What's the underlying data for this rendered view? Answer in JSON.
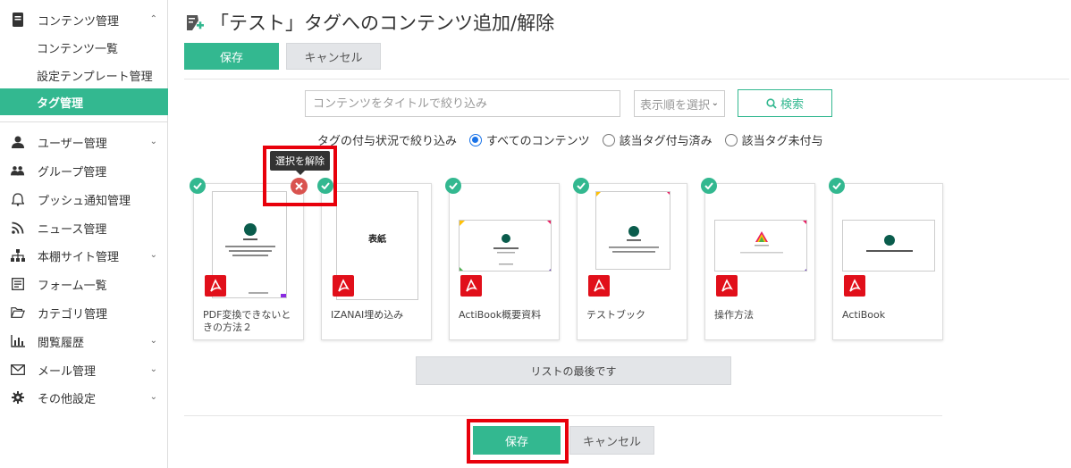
{
  "sidebar": {
    "content_mgmt": "コンテンツ管理",
    "content_list": "コンテンツ一覧",
    "template_mgmt": "設定テンプレート管理",
    "tag_mgmt": "タグ管理",
    "user_mgmt": "ユーザー管理",
    "group_mgmt": "グループ管理",
    "push_mgmt": "プッシュ通知管理",
    "news_mgmt": "ニュース管理",
    "shelf_mgmt": "本棚サイト管理",
    "form_list": "フォーム一覧",
    "category_mgmt": "カテゴリ管理",
    "history": "閲覧履歴",
    "mail_mgmt": "メール管理",
    "other_settings": "その他設定"
  },
  "header": {
    "title": "「テスト」タグへのコンテンツ追加/解除",
    "save_label": "保存",
    "cancel_label": "キャンセル"
  },
  "search": {
    "placeholder": "コンテンツをタイトルで絞り込み",
    "sort_label": "表示順を選択",
    "search_label": "検索"
  },
  "filter": {
    "label": "タグの付与状況で絞り込み",
    "options": [
      "すべてのコンテンツ",
      "該当タグ付与済み",
      "該当タグ未付与"
    ],
    "selected": 0
  },
  "tooltip": "選択を解除",
  "cards": [
    {
      "label": "PDF変換できないときの方法２"
    },
    {
      "label": "IZANAI埋め込み",
      "thumb_text": "表紙"
    },
    {
      "label": "ActiBook概要資料"
    },
    {
      "label": "テストブック"
    },
    {
      "label": "操作方法"
    },
    {
      "label": "ActiBook"
    }
  ],
  "list_end": "リストの最後です",
  "footer": {
    "save_label": "保存",
    "cancel_label": "キャンセル"
  },
  "colors": {
    "accent": "#33b890",
    "highlight": "#e8000b",
    "pdf_red": "#e10f1a",
    "remove_red": "#d9534f"
  }
}
